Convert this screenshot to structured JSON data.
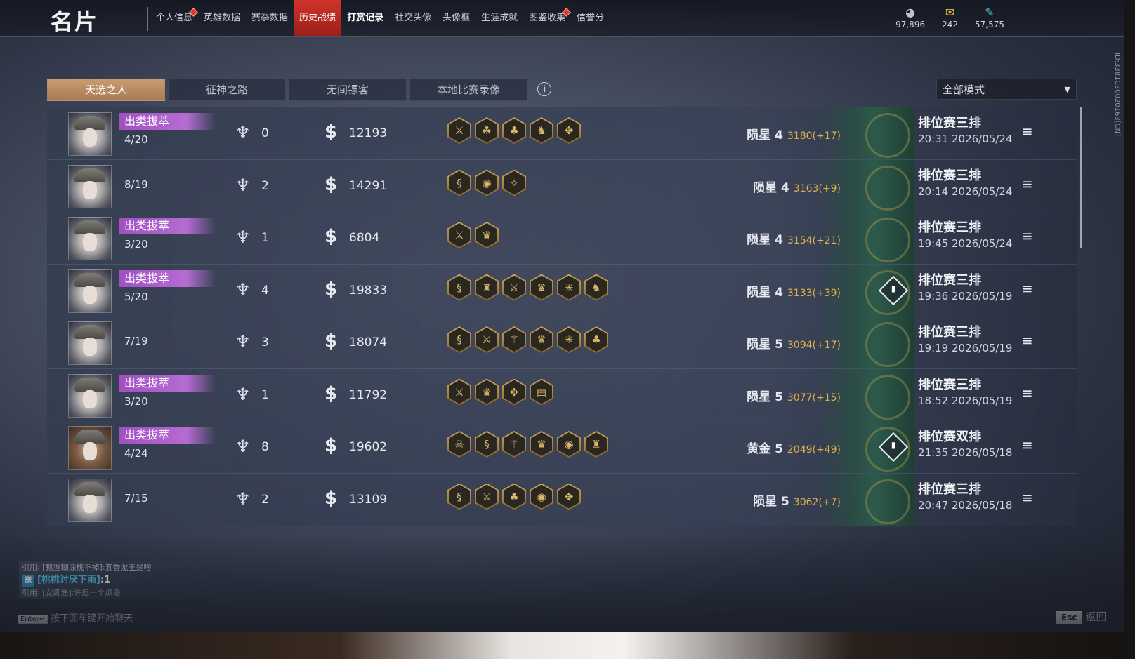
{
  "header": {
    "title": "名片",
    "tabs": [
      {
        "label": "个人信息",
        "dot": true,
        "active": false,
        "bold": false
      },
      {
        "label": "英雄数据",
        "dot": false,
        "active": false,
        "bold": false
      },
      {
        "label": "赛季数据",
        "dot": false,
        "active": false,
        "bold": false
      },
      {
        "label": "历史战绩",
        "dot": false,
        "active": true,
        "bold": false
      },
      {
        "label": "打赏记录",
        "dot": false,
        "active": false,
        "bold": true
      },
      {
        "label": "社交头像",
        "dot": false,
        "active": false,
        "bold": false
      },
      {
        "label": "头像框",
        "dot": false,
        "active": false,
        "bold": false
      },
      {
        "label": "生涯成就",
        "dot": false,
        "active": false,
        "bold": false
      },
      {
        "label": "图鉴收集",
        "dot": true,
        "active": false,
        "bold": false
      },
      {
        "label": "信誉分",
        "dot": false,
        "active": false,
        "bold": false
      }
    ],
    "currencies": [
      {
        "icon": "silver-coin-icon",
        "value": "97,896"
      },
      {
        "icon": "gold-ticket-icon",
        "value": "242"
      },
      {
        "icon": "jade-feather-icon",
        "value": "57,575"
      }
    ],
    "side_id": "ID:3381030020163[CN]"
  },
  "filters": {
    "tabs": [
      "天选之人",
      "征神之路",
      "无间镖客",
      "本地比赛录像"
    ],
    "active_index": 0,
    "mode_select": "全部模式"
  },
  "matches": [
    {
      "badge": "出类拔萃",
      "kda": "4/20",
      "crowns": "0",
      "money": "12193",
      "items": [
        "⚔",
        "☘",
        "♣",
        "♞",
        "✥"
      ],
      "rank": "陨星 4",
      "score": "3180(+17)",
      "stats": false,
      "mode": "排位赛三排",
      "time": "20:31  2026/05/24",
      "avatar": "female"
    },
    {
      "badge": "",
      "kda": "8/19",
      "crowns": "2",
      "money": "14291",
      "items": [
        "§",
        "◉",
        "✧"
      ],
      "rank": "陨星 4",
      "score": "3163(+9)",
      "stats": false,
      "mode": "排位赛三排",
      "time": "20:14  2026/05/24",
      "avatar": "female"
    },
    {
      "badge": "出类拔萃",
      "kda": "3/20",
      "crowns": "1",
      "money": "6804",
      "items": [
        "⚔",
        "♛"
      ],
      "rank": "陨星 4",
      "score": "3154(+21)",
      "stats": false,
      "mode": "排位赛三排",
      "time": "19:45  2026/05/24",
      "avatar": "female"
    },
    {
      "badge": "出类拔萃",
      "kda": "5/20",
      "crowns": "4",
      "money": "19833",
      "items": [
        "§",
        "♜",
        "⚔",
        "♛",
        "✳",
        "♞"
      ],
      "rank": "陨星 4",
      "score": "3133(+39)",
      "stats": true,
      "mode": "排位赛三排",
      "time": "19:36  2026/05/19",
      "avatar": "female"
    },
    {
      "badge": "",
      "kda": "7/19",
      "crowns": "3",
      "money": "18074",
      "items": [
        "§",
        "⚔",
        "⚚",
        "♛",
        "✳",
        "♣"
      ],
      "rank": "陨星 5",
      "score": "3094(+17)",
      "stats": false,
      "mode": "排位赛三排",
      "time": "19:19  2026/05/19",
      "avatar": "female"
    },
    {
      "badge": "出类拔萃",
      "kda": "3/20",
      "crowns": "1",
      "money": "11792",
      "items": [
        "⚔",
        "♛",
        "✥",
        "▤"
      ],
      "rank": "陨星 5",
      "score": "3077(+15)",
      "stats": false,
      "mode": "排位赛三排",
      "time": "18:52  2026/05/19",
      "avatar": "female"
    },
    {
      "badge": "出类拔萃",
      "kda": "4/24",
      "crowns": "8",
      "money": "19602",
      "items": [
        "☠",
        "§",
        "⚚",
        "♛",
        "◉",
        "♜"
      ],
      "rank": "黄金 5",
      "score": "2049(+49)",
      "stats": true,
      "mode": "排位赛双排",
      "time": "21:35  2026/05/18",
      "avatar": "male"
    },
    {
      "badge": "",
      "kda": "7/15",
      "crowns": "2",
      "money": "13109",
      "items": [
        "§",
        "⚔",
        "♣",
        "◉",
        "✥"
      ],
      "rank": "陨星 5",
      "score": "3062(+7)",
      "stats": false,
      "mode": "排位赛三排",
      "time": "20:47  2026/05/18",
      "avatar": "female"
    }
  ],
  "chat": {
    "lines": [
      {
        "text": "引用: [狐狸糊涂桃不掉]:五香龙王是啥",
        "highlight": false
      },
      {
        "tag": "瑟",
        "who": "[桃桃讨厌下雨]",
        "text": ":1",
        "highlight": true
      },
      {
        "text": "引用: [安卿渔]:许愿一个瓜岛",
        "highlight": false
      }
    ],
    "enter_key": "Enter↵",
    "enter_hint": "按下回车键开始聊天"
  },
  "footer": {
    "esc_key": "Esc",
    "back_label": "返回"
  }
}
